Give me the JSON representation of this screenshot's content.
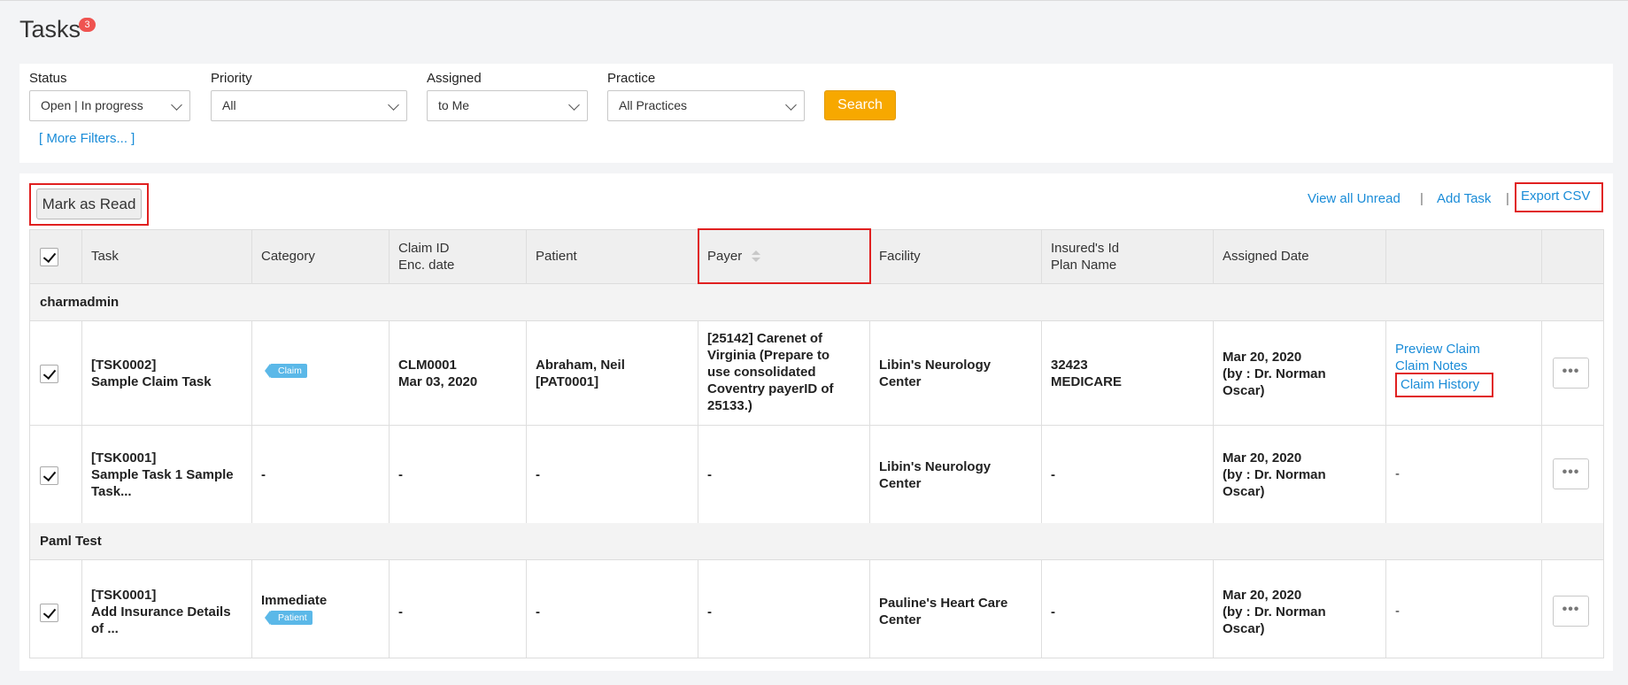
{
  "page": {
    "title": "Tasks",
    "badge_count": "3"
  },
  "filters": {
    "status": {
      "label": "Status",
      "value": "Open | In progress"
    },
    "priority": {
      "label": "Priority",
      "value": "All"
    },
    "assigned": {
      "label": "Assigned",
      "value": "to Me"
    },
    "practice": {
      "label": "Practice",
      "value": "All Practices"
    },
    "search_label": "Search",
    "more_filters": "[ More Filters... ]"
  },
  "toolbar": {
    "mark_as_read": "Mark as Read",
    "view_all_unread": "View all Unread",
    "add_task": "Add Task",
    "export_csv": "Export CSV",
    "separator": "|"
  },
  "table": {
    "headers": {
      "task": "Task",
      "category": "Category",
      "claim_id": "Claim ID",
      "enc_date": "Enc. date",
      "patient": "Patient",
      "payer": "Payer",
      "facility": "Facility",
      "insured_id": "Insured's Id",
      "plan_name": "Plan Name",
      "assigned_date": "Assigned Date"
    },
    "groups": [
      {
        "name": "charmadmin",
        "rows": [
          {
            "task_id": "[TSK0002]",
            "task_name": "Sample Claim Task",
            "category": "",
            "category_tag": "Claim",
            "claim_id": "CLM0001",
            "enc_date": "Mar 03, 2020",
            "patient_name": "Abraham, Neil",
            "patient_id": "[PAT0001]",
            "payer": [
              "[25142] Carenet of",
              "Virginia (Prepare to",
              "use consolidated",
              "Coventry payerID of",
              "25133.)"
            ],
            "facility": [
              "Libin's Neurology",
              "Center"
            ],
            "insured_id": "32423",
            "plan_name": "MEDICARE",
            "assigned_date": "Mar 20, 2020",
            "assigned_by": [
              "(by : Dr. Norman",
              "Oscar)"
            ],
            "actions": [
              "Preview Claim",
              "Claim Notes",
              "Claim History"
            ]
          },
          {
            "task_id": "[TSK0001]",
            "task_name": [
              "Sample Task 1 Sample",
              "Task..."
            ],
            "category": "-",
            "claim_id": "-",
            "patient": "-",
            "payer": "-",
            "facility": [
              "Libin's Neurology",
              "Center"
            ],
            "insured_id": "-",
            "assigned_date": "Mar 20, 2020",
            "assigned_by": [
              "(by : Dr. Norman",
              "Oscar)"
            ],
            "actions": "-"
          }
        ]
      },
      {
        "name": "Paml Test",
        "rows": [
          {
            "task_id": "[TSK0001]",
            "task_name": [
              "Add Insurance Details",
              "of ..."
            ],
            "category": "Immediate",
            "category_tag": "Patient",
            "claim_id": "-",
            "patient": "-",
            "payer": "-",
            "facility": [
              "Pauline's Heart Care",
              "Center"
            ],
            "insured_id": "-",
            "assigned_date": "Mar 20, 2020",
            "assigned_by": [
              "(by : Dr. Norman",
              "Oscar)"
            ],
            "actions": "-"
          }
        ]
      }
    ],
    "row_menu": "•••"
  },
  "colors": {
    "accent_link": "#1a8cd8",
    "search_button": "#f7a800",
    "highlight_outline": "#e02020",
    "tag_blue": "#5bb8e8",
    "badge_red": "#ef5350"
  },
  "icons": [
    "chevron-down-icon",
    "sort-icon",
    "checkmark-icon",
    "more-icon"
  ]
}
